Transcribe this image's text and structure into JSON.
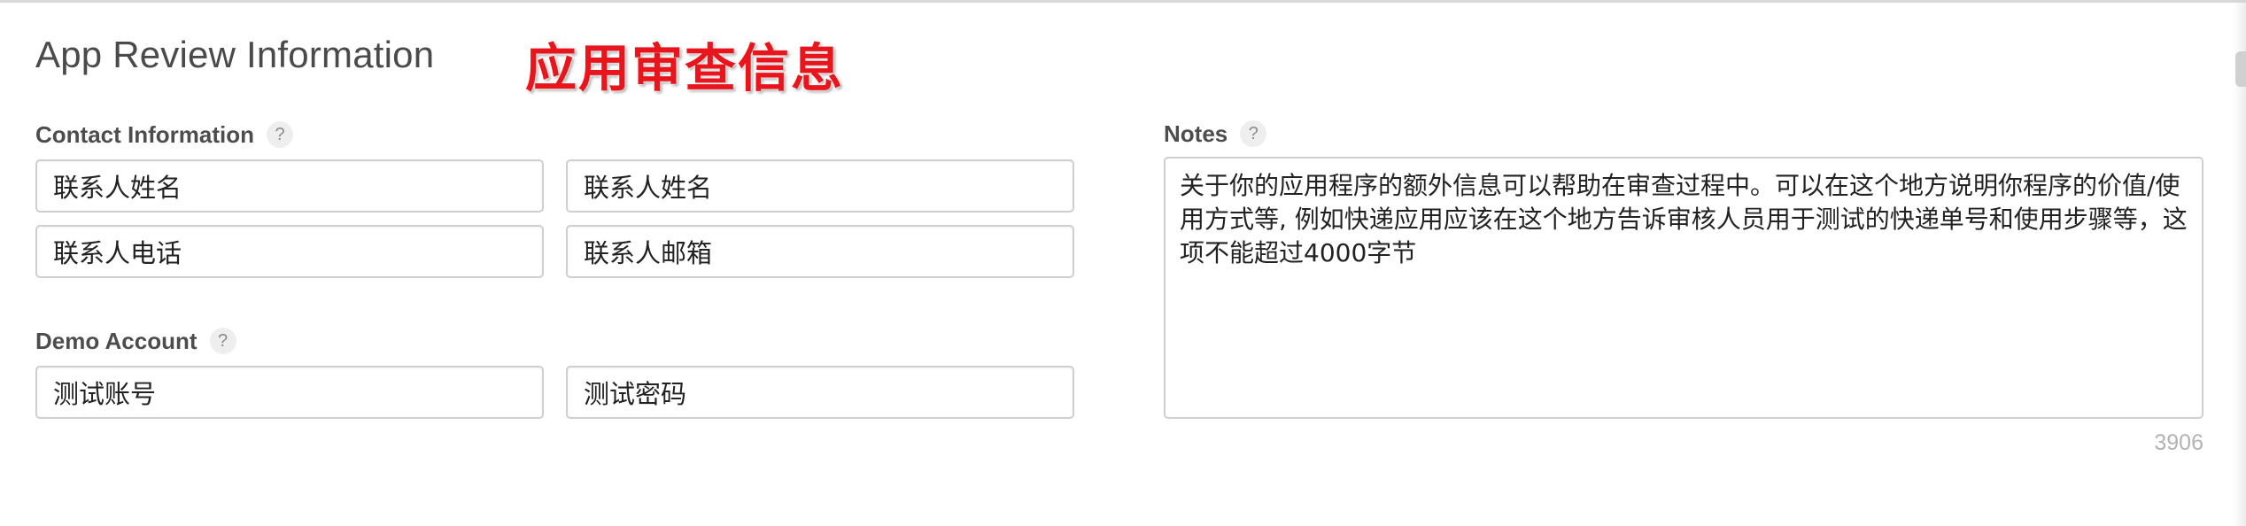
{
  "section": {
    "title": "App Review Information",
    "annotation": "应用审查信息"
  },
  "contact": {
    "label": "Contact Information",
    "help": "?",
    "first_name": "联系人姓名",
    "last_name": "联系人姓名",
    "phone": "联系人电话",
    "email": "联系人邮箱"
  },
  "demo": {
    "label": "Demo Account",
    "help": "?",
    "username": "测试账号",
    "password": "测试密码"
  },
  "notes": {
    "label": "Notes",
    "help": "?",
    "value": "关于你的应用程序的额外信息可以帮助在审查过程中。可以在这个地方说明你程序的价值/使用方式等, 例如快递应用应该在这个地方告诉审核人员用于测试的快递单号和使用步骤等，这项不能超过4000字节",
    "remaining_chars": "3906"
  },
  "icons": {
    "help": "question-mark-circle-icon"
  }
}
